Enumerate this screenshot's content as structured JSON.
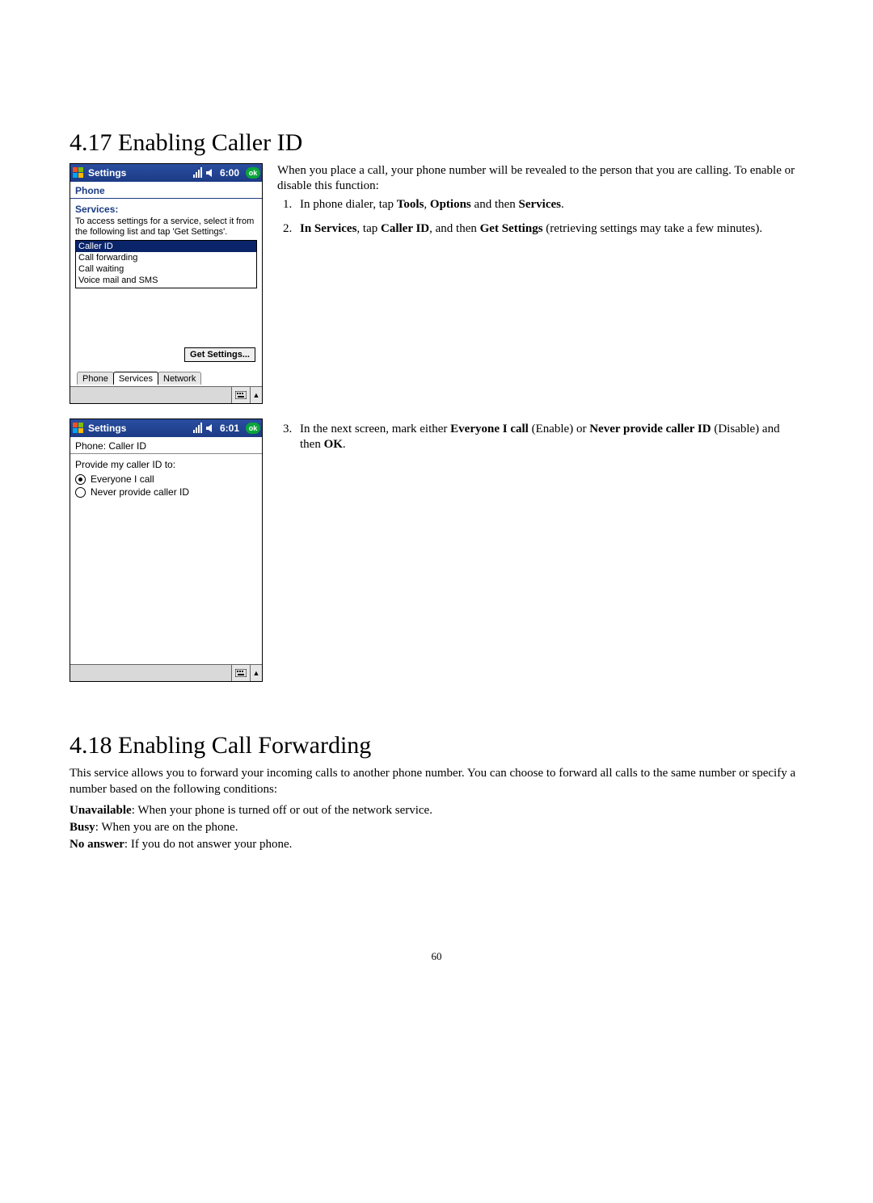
{
  "section417": {
    "heading": "4.17  Enabling Caller ID",
    "intro": "When you place a call, your phone number will be revealed to the person that you are calling. To enable or disable this function:",
    "step1_pre": "In phone dialer, tap ",
    "step1_b1": "Tools",
    "step1_mid1": ", ",
    "step1_b2": "Options",
    "step1_mid2": " and then ",
    "step1_b3": "Services",
    "step1_end": ".",
    "step2_b1": "In Services",
    "step2_mid1": ", tap ",
    "step2_b2": "Caller ID",
    "step2_mid2": ", and then ",
    "step2_b3": "Get Settings",
    "step2_end": " (retrieving settings may take a few minutes).",
    "step3_pre": "In the next screen, mark either ",
    "step3_b1": "Everyone I call",
    "step3_mid1": " (Enable) or ",
    "step3_b2": "Never provide caller ID",
    "step3_mid2": " (Disable) and then ",
    "step3_b3": "OK",
    "step3_end": "."
  },
  "phone1": {
    "title": "Settings",
    "time": "6:00",
    "ok": "ok",
    "subheader": "Phone",
    "services_label": "Services:",
    "hint": "To access settings for a service, select it from the following list and tap 'Get Settings'.",
    "items": {
      "i0": "Caller ID",
      "i1": "Call forwarding",
      "i2": "Call waiting",
      "i3": "Voice mail and SMS"
    },
    "get_settings": "Get Settings...",
    "tabs": {
      "t0": "Phone",
      "t1": "Services",
      "t2": "Network"
    }
  },
  "phone2": {
    "title": "Settings",
    "time": "6:01",
    "ok": "ok",
    "subheader": "Phone: Caller ID",
    "label": "Provide my caller ID to:",
    "opt1": "Everyone I call",
    "opt2": "Never provide caller ID"
  },
  "section418": {
    "heading": "4.18  Enabling Call Forwarding",
    "para": "This service allows you to forward your incoming calls to another phone number. You can choose to forward all calls to the same number or specify a number based on the following conditions:",
    "c1b": "Unavailable",
    "c1": ": When your phone is turned off or out of the network service.",
    "c2b": "Busy",
    "c2": ": When you are on the phone.",
    "c3b": "No answer",
    "c3": ": If you do not answer your phone."
  },
  "page_number": "60"
}
